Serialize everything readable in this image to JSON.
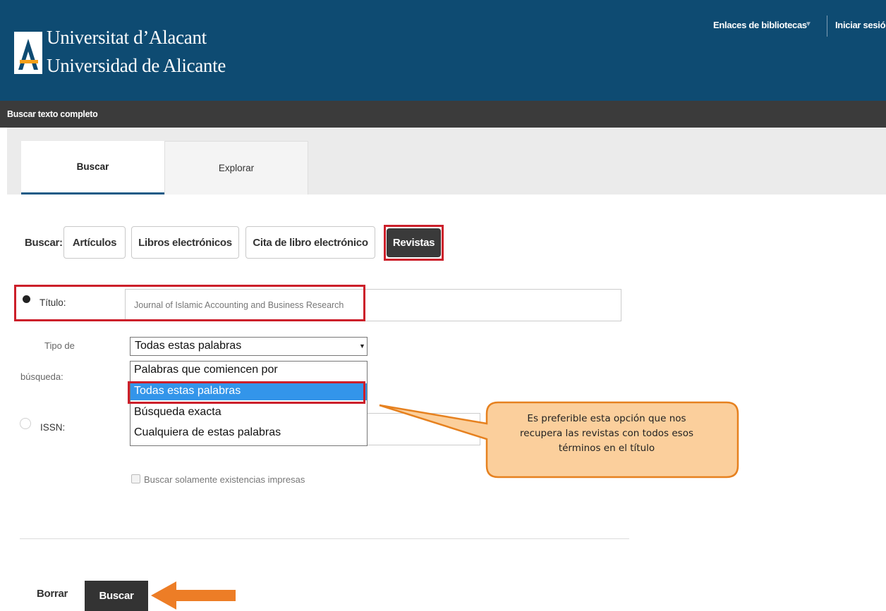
{
  "header": {
    "brand_line1": "Universitat d’Alacant",
    "brand_line2": "Universidad de Alicante",
    "library_links": "Enlaces de bibliotecas",
    "login": "Iniciar sesión"
  },
  "subbar": {
    "title": "Buscar texto completo"
  },
  "tabs": [
    {
      "label": "Buscar",
      "active": true
    },
    {
      "label": "Explorar",
      "active": false
    }
  ],
  "search_types": {
    "label": "Buscar:",
    "options": [
      "Artículos",
      "Libros electrónicos",
      "Cita de libro electrónico",
      "Revistas"
    ],
    "selected": "Revistas"
  },
  "title_field": {
    "label": "Título:",
    "value": "Journal of Islamic Accounting and Business Research"
  },
  "search_mode": {
    "label_line1": "Tipo de",
    "label_line2": "búsqueda:",
    "selected": "Todas estas palabras",
    "options": [
      "Palabras que comiencen por",
      "Todas estas palabras",
      "Búsqueda exacta",
      "Cualquiera de estas palabras"
    ]
  },
  "issn_field": {
    "label": "ISSN:"
  },
  "print_only": {
    "label": "Buscar solamente existencias impresas"
  },
  "callout": {
    "line1": "Es preferible esta opción que nos",
    "line2": "recupera las revistas con todos esos",
    "line3": "términos en el título"
  },
  "actions": {
    "clear": "Borrar",
    "search": "Buscar"
  },
  "colors": {
    "header_bg": "#0e4b72",
    "subbar_bg": "#3b3b3b",
    "highlight_red": "#cc1f2a",
    "callout_fill": "#fbcf9c",
    "callout_stroke": "#e6811f",
    "arrow_orange": "#ed7d26",
    "selected_option": "#3395ea"
  }
}
